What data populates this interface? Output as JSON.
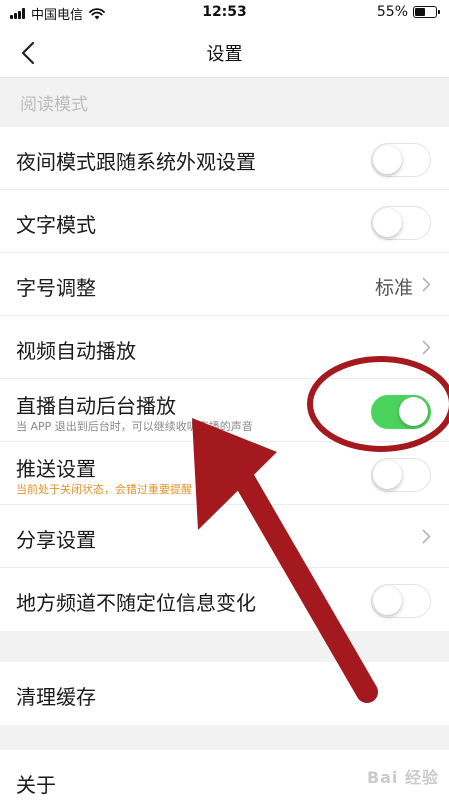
{
  "status_bar": {
    "carrier": "中国电信",
    "time": "12:53",
    "battery": "55%",
    "battery_level": 0.55
  },
  "nav": {
    "title": "设置"
  },
  "reading_section": {
    "header": "阅读模式"
  },
  "settings": {
    "night_mode": {
      "label": "夜间模式跟随系统外观设置",
      "enabled": false
    },
    "text_mode": {
      "label": "文字模式",
      "enabled": false
    },
    "font_size": {
      "label": "字号调整",
      "value": "标准"
    },
    "video_autoplay": {
      "label": "视频自动播放"
    },
    "live_background": {
      "label": "直播自动后台播放",
      "sub": "当 APP 退出到后台时，可以继续收听直播的声音",
      "enabled": true
    },
    "push": {
      "label": "推送设置",
      "sub": "当前处于关闭状态，会错过重要提醒",
      "enabled": false
    },
    "share": {
      "label": "分享设置"
    },
    "local_channel": {
      "label": "地方频道不随定位信息变化",
      "enabled": false
    }
  },
  "cache": {
    "label": "清理缓存"
  },
  "about": {
    "label": "关于"
  },
  "watermark": "Bai 经验",
  "colors": {
    "switch_on": "#4cd35d",
    "annotation": "#a3191e",
    "accent_sub": "#e4932c"
  }
}
